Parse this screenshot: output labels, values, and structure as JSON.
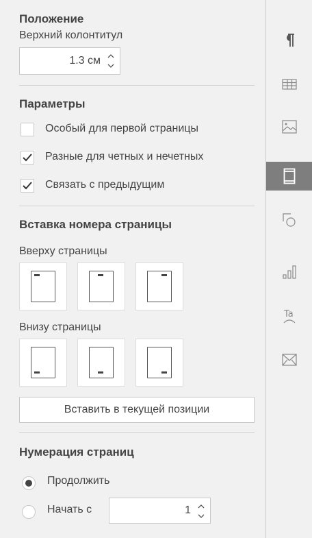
{
  "position": {
    "heading": "Положение",
    "header_label": "Верхний колонтитул",
    "header_value": "1.3 см"
  },
  "params": {
    "heading": "Параметры",
    "options": [
      {
        "label": "Особый для первой страницы",
        "checked": false
      },
      {
        "label": "Разные для четных и нечетных",
        "checked": true
      },
      {
        "label": "Связать с предыдущим",
        "checked": true
      }
    ]
  },
  "page_number": {
    "heading": "Вставка номера страницы",
    "top_label": "Вверху страницы",
    "bottom_label": "Внизу страницы",
    "insert_button": "Вставить в текущей позиции"
  },
  "numbering": {
    "heading": "Нумерация страниц",
    "continue_label": "Продолжить",
    "start_label": "Начать с",
    "start_value": "1",
    "selected": "continue"
  },
  "rail": {
    "icons": [
      "paragraph-icon",
      "table-icon",
      "image-icon",
      "header-footer-icon",
      "shape-icon",
      "chart-icon",
      "text-art-icon",
      "mail-merge-icon"
    ],
    "active": "header-footer-icon",
    "active_color": "#7e7e7e"
  }
}
